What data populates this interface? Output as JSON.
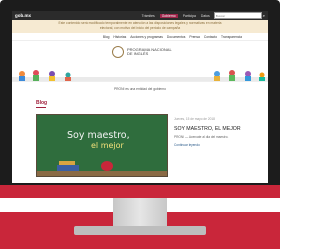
{
  "site": {
    "logo": "gob.mx",
    "top_links": [
      "Trámites",
      "Gobierno",
      "Participa",
      "Datos"
    ],
    "active_top_link": "Gobierno",
    "search_placeholder": "Buscar"
  },
  "notice": "Este contenido será modificado temporalmente en atención a las disposiciones legales y normativas en materia electoral, con motivo del inicio del periodo de campaña",
  "nav": {
    "items": [
      "Blog",
      "Historias",
      "Acciones y programas",
      "Documentos",
      "Prensa",
      "Contacto",
      "Transparencia"
    ]
  },
  "banner": {
    "org_line1": "PROGRAMA NACIONAL",
    "org_line2": "DE INGLÉS"
  },
  "infoline": "PRONI es una entidad del gobierno",
  "blog": {
    "heading": "Blog",
    "post": {
      "date": "Jueves, 15 de mayo de 2018",
      "title": "SOY MAESTRO, EL MEJOR",
      "excerpt": "PRONI — Acercate al dia del maestro.",
      "more": "Continuar leyendo",
      "chalk_line1": "Soy maestro,",
      "chalk_line2": "el mejor"
    }
  },
  "colors": {
    "brand": "#9d2449",
    "frame": "#1c1c1c",
    "floor": "#c9263a"
  }
}
